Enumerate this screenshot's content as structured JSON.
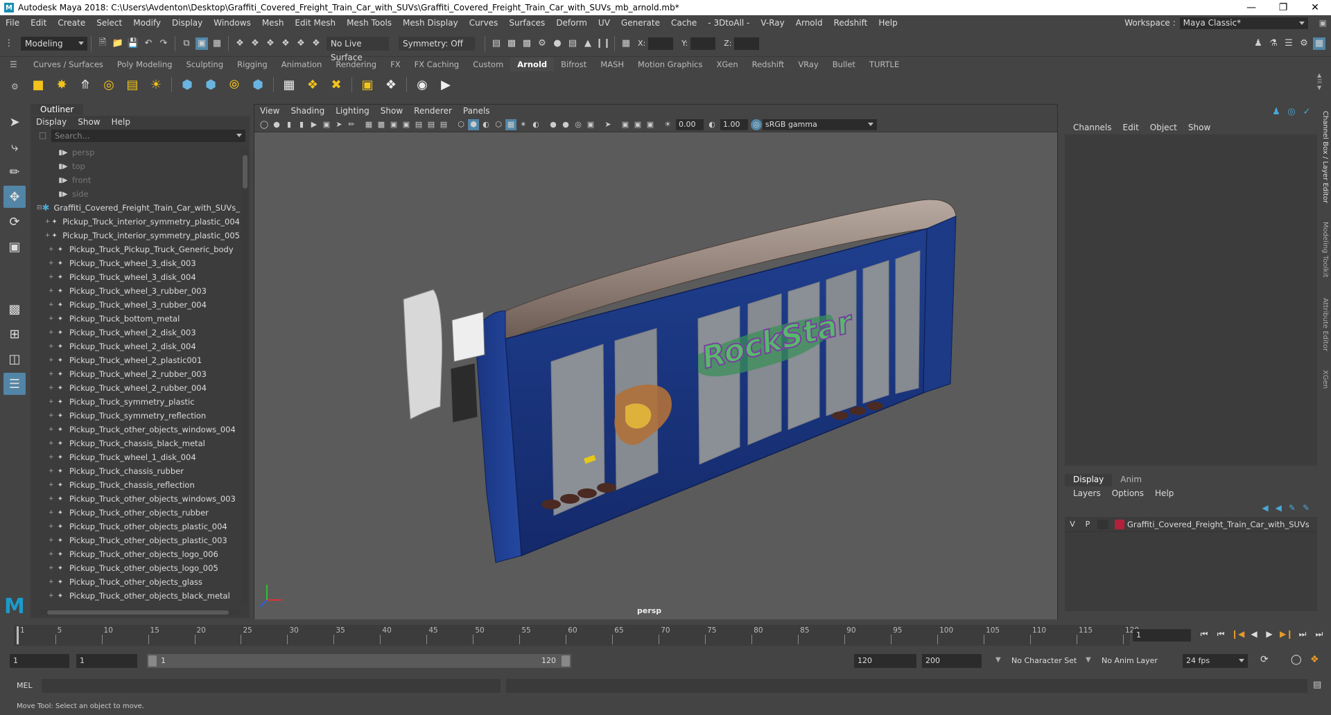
{
  "window": {
    "title": "Autodesk Maya 2018: C:\\Users\\Avdenton\\Desktop\\Graffiti_Covered_Freight_Train_Car_with_SUVs\\Graffiti_Covered_Freight_Train_Car_with_SUVs_mb_arnold.mb*",
    "logo_letter": "M",
    "controls": [
      "—",
      "❐",
      "✕"
    ]
  },
  "menubar": {
    "items": [
      "File",
      "Edit",
      "Create",
      "Select",
      "Modify",
      "Display",
      "Windows",
      "Mesh",
      "Edit Mesh",
      "Mesh Tools",
      "Mesh Display",
      "Curves",
      "Surfaces",
      "Deform",
      "UV",
      "Generate",
      "Cache",
      "- 3DtoAll -",
      "V-Ray",
      "Arnold",
      "Redshift",
      "Help"
    ],
    "workspace_label": "Workspace :",
    "workspace_value": "Maya Classic*"
  },
  "statusline": {
    "mode": "Modeling",
    "live_surface": "No Live Surface",
    "symmetry": "Symmetry: Off",
    "x_label": "X:",
    "y_label": "Y:",
    "z_label": "Z:"
  },
  "shelf": {
    "tabs": [
      "Curves / Surfaces",
      "Poly Modeling",
      "Sculpting",
      "Rigging",
      "Animation",
      "Rendering",
      "FX",
      "FX Caching",
      "Custom",
      "Arnold",
      "Bifrost",
      "MASH",
      "Motion Graphics",
      "XGen",
      "Redshift",
      "VRay",
      "Bullet",
      "TURTLE"
    ],
    "active_tab": "Arnold"
  },
  "outliner": {
    "title": "Outliner",
    "menu": [
      "Display",
      "Show",
      "Help"
    ],
    "search_placeholder": "Search...",
    "cameras": [
      "persp",
      "top",
      "front",
      "side"
    ],
    "group": "Graffiti_Covered_Freight_Train_Car_with_SUVs_",
    "items": [
      "Pickup_Truck_interior_symmetry_plastic_004",
      "Pickup_Truck_interior_symmetry_plastic_005",
      "Pickup_Truck_Pickup_Truck_Generic_body",
      "Pickup_Truck_wheel_3_disk_003",
      "Pickup_Truck_wheel_3_disk_004",
      "Pickup_Truck_wheel_3_rubber_003",
      "Pickup_Truck_wheel_3_rubber_004",
      "Pickup_Truck_bottom_metal",
      "Pickup_Truck_wheel_2_disk_003",
      "Pickup_Truck_wheel_2_disk_004",
      "Pickup_Truck_wheel_2_plastic001",
      "Pickup_Truck_wheel_2_rubber_003",
      "Pickup_Truck_wheel_2_rubber_004",
      "Pickup_Truck_symmetry_plastic",
      "Pickup_Truck_symmetry_reflection",
      "Pickup_Truck_other_objects_windows_004",
      "Pickup_Truck_chassis_black_metal",
      "Pickup_Truck_wheel_1_disk_004",
      "Pickup_Truck_chassis_rubber",
      "Pickup_Truck_chassis_reflection",
      "Pickup_Truck_other_objects_windows_003",
      "Pickup_Truck_other_objects_rubber",
      "Pickup_Truck_other_objects_plastic_004",
      "Pickup_Truck_other_objects_plastic_003",
      "Pickup_Truck_other_objects_logo_006",
      "Pickup_Truck_other_objects_logo_005",
      "Pickup_Truck_other_objects_glass",
      "Pickup_Truck_other_objects_black_metal"
    ]
  },
  "viewport": {
    "menu": [
      "View",
      "Shading",
      "Lighting",
      "Show",
      "Renderer",
      "Panels"
    ],
    "value_a": "0.00",
    "value_b": "1.00",
    "color_space": "sRGB gamma",
    "camera_label": "persp",
    "graffiti_text": "RockStar"
  },
  "channelbox": {
    "menu": [
      "Channels",
      "Edit",
      "Object",
      "Show"
    ],
    "layer_tabs": [
      "Display",
      "Anim"
    ],
    "layer_menu": [
      "Layers",
      "Options",
      "Help"
    ],
    "layer": {
      "v": "V",
      "p": "P",
      "name": "Graffiti_Covered_Freight_Train_Car_with_SUVs",
      "color": "#b3203a"
    },
    "side_tabs": [
      "Channel Box / Layer Editor",
      "Modeling Toolkit",
      "Attribute Editor",
      "XGen"
    ]
  },
  "timeline": {
    "tick_labels": [
      "1",
      "5",
      "10",
      "15",
      "20",
      "25",
      "30",
      "35",
      "40",
      "45",
      "50",
      "55",
      "60",
      "65",
      "70",
      "75",
      "80",
      "85",
      "90",
      "95",
      "100",
      "105",
      "110",
      "115",
      "120"
    ],
    "current_frame": "1"
  },
  "range": {
    "start": "1",
    "anim_start": "1",
    "range_start": "1",
    "range_end": "120",
    "end": "120",
    "anim_end": "200",
    "character_set": "No Character Set",
    "anim_layer": "No Anim Layer",
    "fps": "24 fps"
  },
  "command": {
    "label": "MEL"
  },
  "help": {
    "text": "Move Tool: Select an object to move."
  }
}
